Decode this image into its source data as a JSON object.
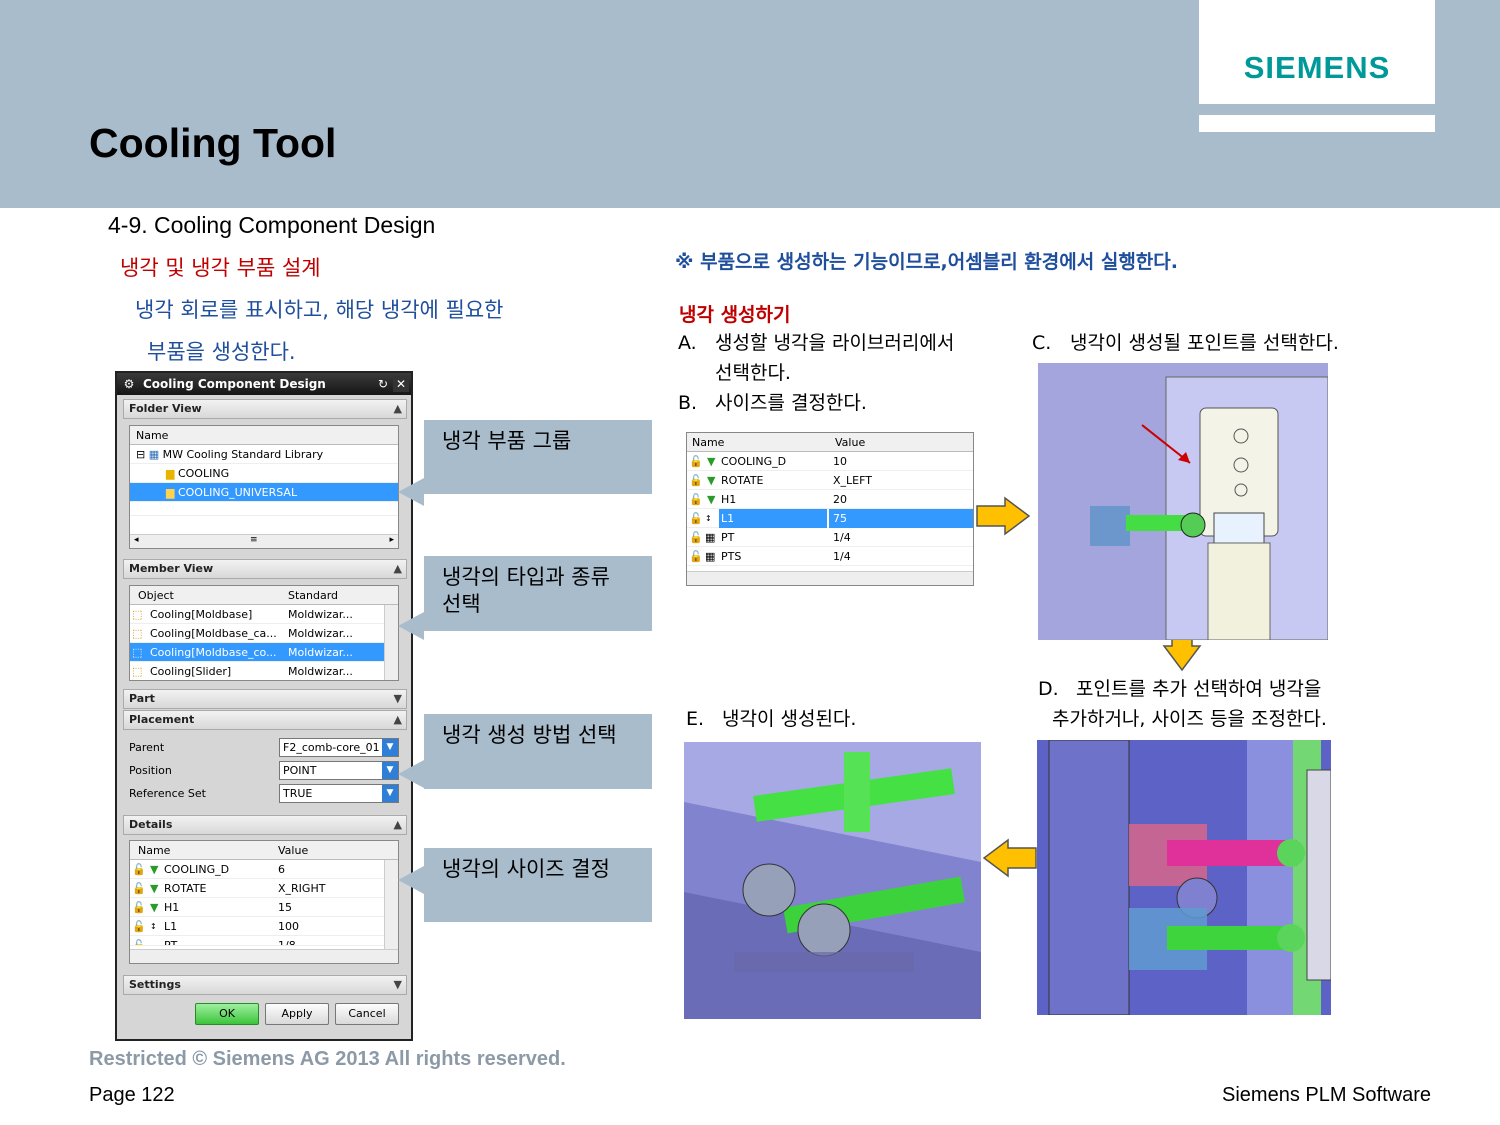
{
  "header": {
    "title": "Cooling Tool",
    "logo": "SIEMENS"
  },
  "section_heading": "4-9.  Cooling Component Design",
  "left_intro": {
    "line1": "냉각 및 냉각 부품 설계",
    "line2": "냉각 회로를 표시하고, 해당 냉각에 필요한",
    "line3": "부품을 생성한다."
  },
  "note": "※ 부품으로 생성하는 기능이므로,어셈블리 환경에서 실행한다.",
  "create_heading": "냉각 생성하기",
  "steps": {
    "a_label": "A.",
    "a_line1": "생성할 냉각을 라이브러리에서",
    "a_line2": "선택한다.",
    "b_label": "B.",
    "b_text": "사이즈를 결정한다.",
    "c_label": "C.",
    "c_text": "냉각이 생성될 포인트를 선택한다.",
    "d_label": "D.",
    "d_line1": "포인트를 추가 선택하여 냉각을",
    "d_line2": "추가하거나, 사이즈 등을 조정한다.",
    "e_label": "E.",
    "e_text": "냉각이 생성된다."
  },
  "dialog": {
    "title": "Cooling Component Design",
    "folder_view": {
      "label": "Folder View",
      "col_name": "Name",
      "root": "MW Cooling Standard Library",
      "items": [
        "COOLING",
        "COOLING_UNIVERSAL"
      ]
    },
    "member_view": {
      "label": "Member View",
      "col_object": "Object",
      "col_standard": "Standard",
      "rows": [
        {
          "object": "Cooling[Moldbase]",
          "standard": "Moldwizar..."
        },
        {
          "object": "Cooling[Moldbase_ca...",
          "standard": "Moldwizar..."
        },
        {
          "object": "Cooling[Moldbase_co...",
          "standard": "Moldwizar..."
        },
        {
          "object": "Cooling[Slider]",
          "standard": "Moldwizar..."
        }
      ]
    },
    "part_label": "Part",
    "placement": {
      "label": "Placement",
      "parent_label": "Parent",
      "parent_value": "F2_comb-core_01",
      "position_label": "Position",
      "position_value": "POINT",
      "refset_label": "Reference Set",
      "refset_value": "TRUE"
    },
    "details": {
      "label": "Details",
      "col_name": "Name",
      "col_value": "Value",
      "rows": [
        {
          "name": "COOLING_D",
          "value": "6"
        },
        {
          "name": "ROTATE",
          "value": "X_RIGHT"
        },
        {
          "name": "H1",
          "value": "15"
        },
        {
          "name": "L1",
          "value": "100"
        },
        {
          "name": "PT",
          "value": "1/8"
        }
      ]
    },
    "settings_label": "Settings",
    "buttons": {
      "ok": "OK",
      "apply": "Apply",
      "cancel": "Cancel"
    }
  },
  "callouts": {
    "c1": "냉각 부품 그룹",
    "c2_line1": "냉각의 타입과 종류",
    "c2_line2": "선택",
    "c3": "냉각 생성 방법 선택",
    "c4": "냉각의 사이즈 결정"
  },
  "size_table": {
    "col_name": "Name",
    "col_value": "Value",
    "rows": [
      {
        "name": "COOLING_D",
        "value": "10"
      },
      {
        "name": "ROTATE",
        "value": "X_LEFT"
      },
      {
        "name": "H1",
        "value": "20"
      },
      {
        "name": "L1",
        "value": "75"
      },
      {
        "name": "PT",
        "value": "1/4"
      },
      {
        "name": "PTS",
        "value": "1/4"
      }
    ]
  },
  "footer": {
    "restricted": "Restricted © Siemens AG 2013 All rights reserved.",
    "page": "Page 122",
    "company": "Siemens PLM Software"
  },
  "colors": {
    "header_bg": "#a9bccb",
    "logo": "#009999",
    "red": "#c00000",
    "blue": "#1f4e9c",
    "select": "#3399ff",
    "arrow": "#ffc000"
  }
}
